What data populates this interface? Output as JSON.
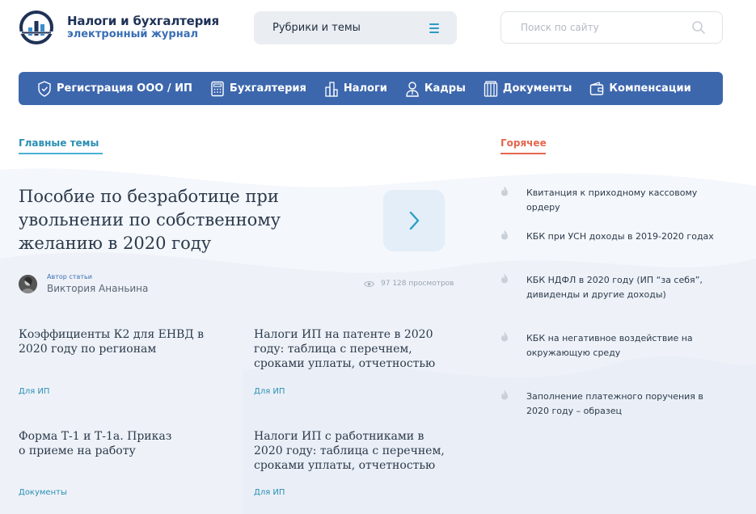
{
  "header": {
    "logo_title": "Налоги и бухгалтерия",
    "logo_subtitle": "электронный журнал",
    "rubrics_label": "Рубрики и темы",
    "search_placeholder": "Поиск по сайту"
  },
  "nav": {
    "items": [
      {
        "label": "Регистрация ООО / ИП",
        "icon": "shield-icon"
      },
      {
        "label": "Бухгалтерия",
        "icon": "calculator-icon"
      },
      {
        "label": "Налоги",
        "icon": "buildings-icon"
      },
      {
        "label": "Кадры",
        "icon": "person-icon"
      },
      {
        "label": "Документы",
        "icon": "documents-icon"
      },
      {
        "label": "Компенсации",
        "icon": "wallet-icon"
      }
    ]
  },
  "main": {
    "section_title": "Главные темы",
    "featured": {
      "title": "Пособие по безработице при увольнении по собственному желанию в 2020 году",
      "author_caption": "Автор статьи",
      "author_name": "Виктория Ананьина",
      "views": "97 128 просмотров"
    },
    "cards": [
      {
        "title": "Коэффициенты К2 для ЕНВД в 2020 году по регионам",
        "tag": "Для ИП"
      },
      {
        "title": "Налоги ИП на патенте в 2020 году: таблица с перечнем, сроками уплаты, отчетностью",
        "tag": "Для ИП"
      },
      {
        "title": "Форма Т-1 и Т-1а. Приказ о приеме на работу",
        "tag": "Документы"
      },
      {
        "title": "Налоги ИП с работниками в 2020 году: таблица с перечнем, сроками уплаты, отчетностью",
        "tag": "Для ИП"
      }
    ]
  },
  "hot": {
    "section_title": "Горячее",
    "items": [
      {
        "label": "Квитанция к приходному кассовому ордеру"
      },
      {
        "label": "КБК при УСН доходы в 2019-2020 годах"
      },
      {
        "label": "КБК НДФЛ в 2020 году (ИП “за себя”, дивиденды и другие доходы)"
      },
      {
        "label": "КБК на негативное воздействие на окружающую среду"
      },
      {
        "label": "Заполнение платежного поручения в 2020 году – образец"
      }
    ]
  },
  "colors": {
    "nav_bg": "#3d67ad",
    "accent_blue": "#2a8fb3",
    "hot_red": "#e4664e",
    "logo_dark": "#1f3257"
  }
}
